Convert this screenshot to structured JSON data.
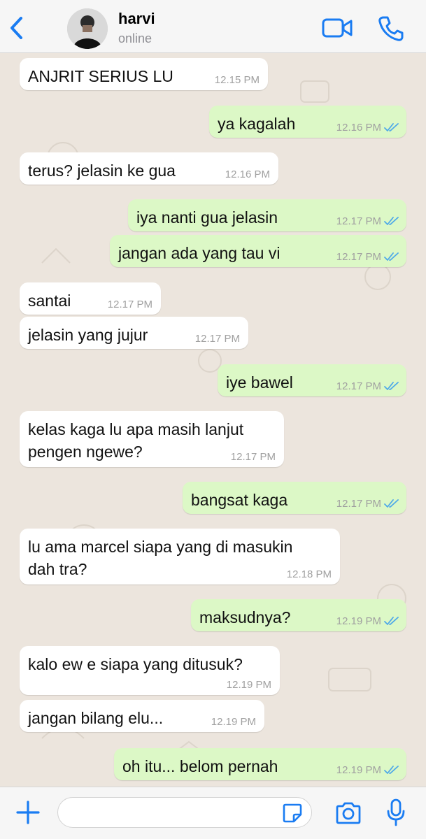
{
  "header": {
    "contact_name": "harvi",
    "status": "online",
    "back_icon": "chevron-left-icon",
    "video_icon": "video-camera-icon",
    "call_icon": "phone-icon"
  },
  "colors": {
    "accent": "#1a7cf2",
    "incoming_bubble": "#ffffff",
    "outgoing_bubble": "#dcf8c6",
    "read_check": "#4fa9e8",
    "chat_background": "#ece5dd"
  },
  "messages": [
    {
      "direction": "in",
      "text": "ANJRIT SERIUS LU",
      "time": "12.15 PM"
    },
    {
      "direction": "out",
      "text": "ya kagalah",
      "time": "12.16 PM",
      "read": true
    },
    {
      "direction": "in",
      "text": "terus? jelasin ke gua",
      "time": "12.16 PM"
    },
    {
      "direction": "out",
      "text": "iya nanti gua jelasin",
      "time": "12.17 PM",
      "read": true
    },
    {
      "direction": "out",
      "text": "jangan ada yang tau vi",
      "time": "12.17 PM",
      "read": true
    },
    {
      "direction": "in",
      "text": "santai",
      "time": "12.17 PM"
    },
    {
      "direction": "in",
      "text": "jelasin yang jujur",
      "time": "12.17 PM"
    },
    {
      "direction": "out",
      "text": "iye bawel",
      "time": "12.17 PM",
      "read": true
    },
    {
      "direction": "in",
      "text": "kelas kaga lu apa masih lanjut\npengen ngewe?",
      "time": "12.17 PM"
    },
    {
      "direction": "out",
      "text": "bangsat kaga",
      "time": "12.17 PM",
      "read": true
    },
    {
      "direction": "in",
      "text": "lu ama marcel siapa yang di masukin\ndah tra?",
      "time": "12.18 PM"
    },
    {
      "direction": "out",
      "text": "maksudnya?",
      "time": "12.19 PM",
      "read": true
    },
    {
      "direction": "in",
      "text": "kalo ew e siapa yang ditusuk?",
      "time": "12.19 PM"
    },
    {
      "direction": "in",
      "text": "jangan bilang elu...",
      "time": "12.19 PM"
    },
    {
      "direction": "out",
      "text": "oh itu... belom pernah",
      "time": "12.19 PM",
      "read": true
    }
  ],
  "input": {
    "value": "",
    "placeholder": "",
    "plus_icon": "plus-icon",
    "sticker_icon": "sticker-icon",
    "camera_icon": "camera-icon",
    "mic_icon": "microphone-icon"
  }
}
